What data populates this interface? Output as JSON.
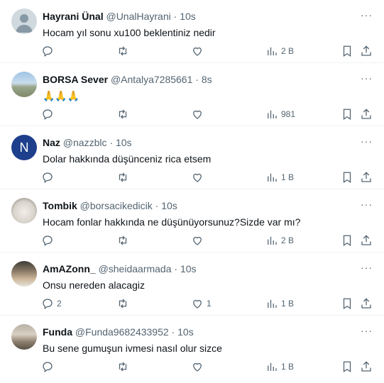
{
  "tweets": [
    {
      "name": "Hayrani Ünal",
      "handle": "@UnalHayrani",
      "dot": "·",
      "time": "10s",
      "text": "Hocam yıl sonu xu100 beklentiniz nedir",
      "replies": "",
      "likes": "",
      "views": "2 B",
      "avatar": "default",
      "avatar_letter": ""
    },
    {
      "name": "BORSA Sever",
      "handle": "@Antalya7285661",
      "dot": "·",
      "time": "8s",
      "text": "🙏🙏🙏",
      "replies": "",
      "likes": "",
      "views": "981",
      "avatar": "photo-sky",
      "avatar_letter": ""
    },
    {
      "name": "Naz",
      "handle": "@nazzblc",
      "dot": "·",
      "time": "10s",
      "text": "Dolar hakkında düşünceniz rica etsem",
      "replies": "",
      "likes": "",
      "views": "1 B",
      "avatar": "letter",
      "avatar_letter": "N"
    },
    {
      "name": "Tombik",
      "handle": "@borsacikedicik",
      "dot": "·",
      "time": "10s",
      "text": "Hocam fonlar hakkında ne düşünüyorsunuz?Sizde var mı?",
      "replies": "",
      "likes": "",
      "views": "2 B",
      "avatar": "photo-cat",
      "avatar_letter": ""
    },
    {
      "name": "AmAZonn_",
      "handle": "@sheidaarmada",
      "dot": "·",
      "time": "10s",
      "text": "Onsu nereden alacagiz",
      "replies": "2",
      "likes": "1",
      "views": "1 B",
      "avatar": "photo-man",
      "avatar_letter": ""
    },
    {
      "name": "Funda",
      "handle": "@Funda9682433952",
      "dot": "·",
      "time": "10s",
      "text": "Bu sene gumuşun ivmesi nasıl olur sizce",
      "replies": "",
      "likes": "",
      "views": "1 B",
      "avatar": "photo-woman",
      "avatar_letter": ""
    }
  ],
  "more_glyph": "···"
}
